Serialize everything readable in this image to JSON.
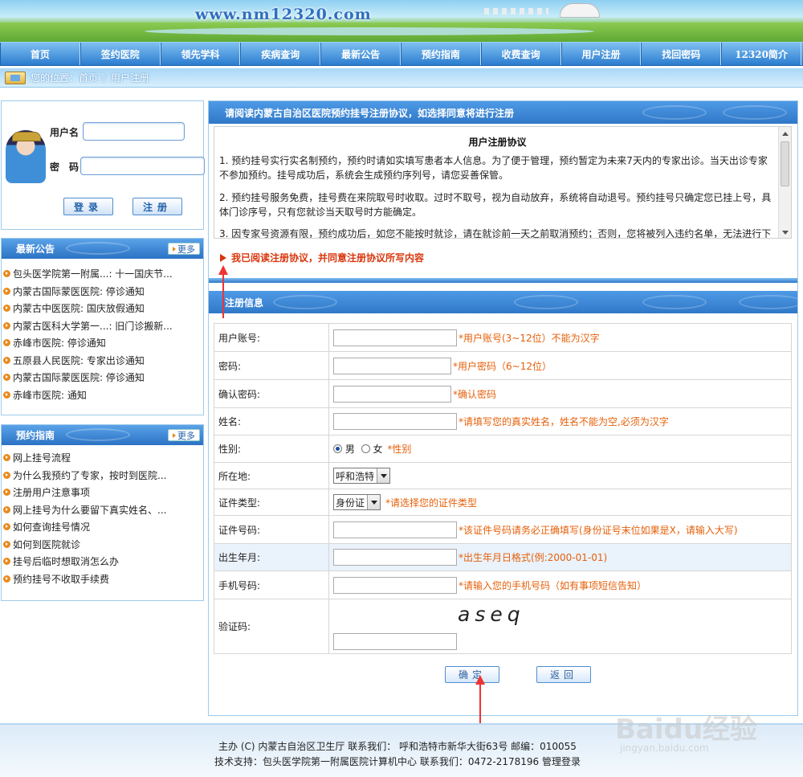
{
  "banner": {
    "url": "www.nm12320.com"
  },
  "nav": [
    "首页",
    "签约医院",
    "领先学科",
    "疾病查询",
    "最新公告",
    "预约指南",
    "收费查询",
    "用户注册",
    "找回密码",
    "12320简介"
  ],
  "breadcrumb": "您的位置：首页 》用户注册",
  "login": {
    "username_label": "用户名",
    "password_label": "密　码",
    "login_button": "登录",
    "register_button": "注册"
  },
  "news": {
    "title": "最新公告",
    "more": "更多",
    "items": [
      "包头医学院第一附属...: 十一国庆节...",
      "内蒙古国际蒙医医院: 停诊通知",
      "内蒙古中医医院: 国庆放假通知",
      "内蒙古医科大学第一...: 旧门诊搬新...",
      "赤峰市医院: 停诊通知",
      "五原县人民医院: 专家出诊通知",
      "内蒙古国际蒙医医院: 停诊通知",
      "赤峰市医院: 通知"
    ]
  },
  "guide": {
    "title": "预约指南",
    "more": "更多",
    "items": [
      "网上挂号流程",
      "为什么我预约了专家，按时到医院...",
      "注册用户注意事项",
      "网上挂号为什么要留下真实姓名、...",
      "如何查询挂号情况",
      "如何到医院就诊",
      "挂号后临时想取消怎么办",
      "预约挂号不收取手续费"
    ]
  },
  "agreement": {
    "header": "请阅读内蒙古自治区医院预约挂号注册协议，如选择同意将进行注册",
    "title": "用户注册协议",
    "p1": "1. 预约挂号实行实名制预约，预约时请如实填写患者本人信息。为了便于管理，预约暂定为未来7天内的专家出诊。当天出诊专家不参加预约。挂号成功后，系统会生成预约序列号，请您妥善保管。",
    "p2": "2. 预约挂号服务免费，挂号费在来院取号时收取。过时不取号，视为自动放弃，系统将自动退号。预约挂号只确定您已挂上号，具体门诊序号，只有您就诊当天取号时方能确定。",
    "p3": "3. 因专家号资源有限，预约成功后，如您不能按时就诊，请在就诊前一天之前取消预约；否则，您将被列入违约名单，无法进行下",
    "check_text": "我已阅读注册协议，并同意注册协议所写内容"
  },
  "reg": {
    "header": "注册信息",
    "rows": {
      "account": {
        "label": "用户账号:",
        "hint": "*用户账号(3~12位）不能为汉字"
      },
      "password": {
        "label": "密码:",
        "hint": "*用户密码（6~12位）"
      },
      "confirm": {
        "label": "确认密码:",
        "hint": "*确认密码"
      },
      "name": {
        "label": "姓名:",
        "hint": "*请填写您的真实姓名，姓名不能为空,必须为汉字"
      },
      "gender": {
        "label": "性别:",
        "male": "男",
        "female": "女",
        "hint": "*性别"
      },
      "location": {
        "label": "所在地:",
        "value": "呼和浩特"
      },
      "id_type": {
        "label": "证件类型:",
        "value": "身份证",
        "hint": "*请选择您的证件类型"
      },
      "id_no": {
        "label": "证件号码:",
        "hint": "*该证件号码请务必正确填写(身份证号末位如果是X，请输入大写)"
      },
      "birth": {
        "label": "出生年月:",
        "hint": "*出生年月日格式(例:2000-01-01)"
      },
      "phone": {
        "label": "手机号码:",
        "hint": "*请输入您的手机号码（如有事项短信告知）"
      },
      "captcha": {
        "label": "验证码:",
        "code": "aseq"
      }
    },
    "confirm_button": "确定",
    "back_button": "返回"
  },
  "footer": {
    "line1": "主办 (C) 内蒙古自治区卫生厅 联系我们：  呼和浩特市新华大街63号 邮编：010055",
    "line2": "技术支持：包头医学院第一附属医院计算机中心 联系我们：0472-2178196 管理登录"
  },
  "watermark": {
    "t1": "Baidu经验",
    "t2": "jingyan.baidu.com"
  }
}
